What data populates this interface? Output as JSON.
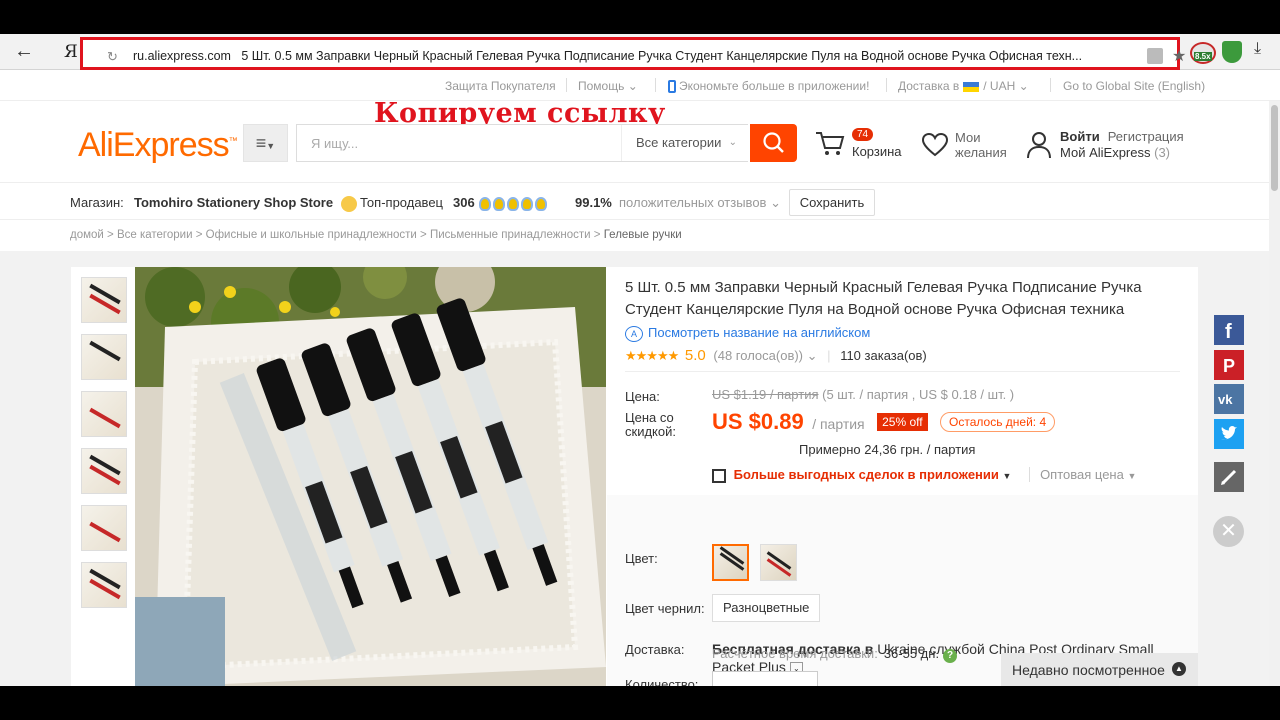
{
  "browser": {
    "back": "←",
    "url_domain": "ru.aliexpress.com",
    "url_title": "5 Шт. 0.5 мм Заправки Черный Красный Гелевая Ручка Подписание Ручка Студент Канцелярские Пуля на Водной основе Ручка Офисная техн...",
    "ext_badge": "8.5x"
  },
  "top_links": {
    "buyer_protection": "Защита Покупателя",
    "help": "Помощь",
    "app": "Экономьте больше в приложении!",
    "delivery": "Доставка в",
    "currency": "/ UAH",
    "global_site": "Go to Global Site (English)"
  },
  "annotation": "Копируем ссылку",
  "header": {
    "logo": "AliExpress",
    "search_placeholder": "Я ищу...",
    "category_select": "Все категории",
    "cart_count": "74",
    "cart_label": "Корзина",
    "wishlist_line1": "Мои",
    "wishlist_line2": "желания",
    "login": "Войти",
    "register": "Регистрация",
    "my_account": "Мой AliExpress",
    "my_account_count": "(3)"
  },
  "store": {
    "label": "Магазин:",
    "name": "Tomohiro Stationery Shop Store",
    "top_seller": "Топ-продавец",
    "score": "306",
    "positive_pct": "99.1%",
    "positive_label": "положительных отзывов",
    "save": "Сохранить"
  },
  "breadcrumbs": [
    "домой",
    "Все категории",
    "Офисные и школьные принадлежности",
    "Письменные принадлежности",
    "Гелевые ручки"
  ],
  "product": {
    "title": "5 Шт. 0.5 мм Заправки Черный Красный Гелевая Ручка Подписание Ручка Студент Канцелярские Пуля на Водной основе Ручка Офисная техника",
    "translate": "Посмотреть название на английском",
    "stars": "★★★★★",
    "rating": "5.0",
    "votes": "(48 голоса(ов))",
    "orders": "110 заказа(ов)",
    "price_label": "Цена:",
    "old_price": "US $1.19 / партия",
    "old_price_note": " (5 шт. / партия , US $ 0.18 / шт. )",
    "discount_label_1": "Цена со",
    "discount_label_2": "скидкой:",
    "new_price": "US $0.89",
    "unit": "/ партия",
    "off": "25% off",
    "days_left": "Осталось дней: 4",
    "approx": "Примерно 24,36 грн. / партия",
    "app_deals": "Больше выгодных сделок в приложении",
    "wholesale": "Оптовая цена",
    "color_label": "Цвет:",
    "ink_label": "Цвет чернил:",
    "ink_value": "Разноцветные",
    "delivery_label": "Доставка:",
    "shipping_bold": "Бесплатная доставка в",
    "shipping_rest": " Ukraine службой China Post Ordinary Small Packet Plus",
    "eta_label": "Расчётное время доставки:",
    "eta_value": "36-55 дн.",
    "qty_label": "Количество:"
  },
  "recently_viewed": "Недавно посмотренное",
  "colors": {
    "accent": "#ff4400",
    "brand": "#ff6a00",
    "annotation": "#e0141e"
  }
}
